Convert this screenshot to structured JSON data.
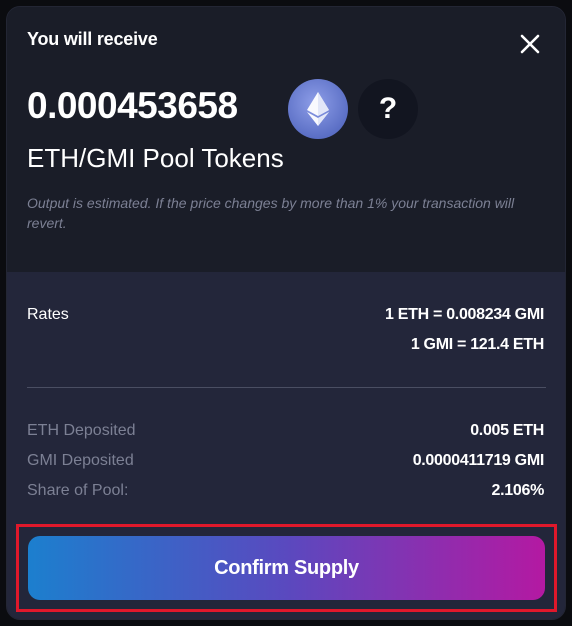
{
  "modal": {
    "title": "You will receive",
    "amount": "0.000453658",
    "pool_label": "ETH/GMI Pool Tokens",
    "note": "Output is estimated. If the price changes by more than 1% your transaction will revert.",
    "tokens": [
      {
        "icon": "ethereum-icon"
      },
      {
        "icon": "unknown-token-icon",
        "glyph": "?"
      }
    ]
  },
  "rates": {
    "label": "Rates",
    "rate1": "1 ETH = 0.008234 GMI",
    "rate2": "1 GMI = 121.4 ETH"
  },
  "details": {
    "eth_deposited_label": "ETH Deposited",
    "eth_deposited_value": "0.005 ETH",
    "gmi_deposited_label": "GMI Deposited",
    "gmi_deposited_value": "0.0000411719 GMI",
    "share_label": "Share of Pool:",
    "share_value": "2.106%"
  },
  "actions": {
    "confirm_label": "Confirm Supply"
  },
  "colors": {
    "modal_top_bg": "#1a1d28",
    "modal_bottom_bg": "#23263a",
    "highlight_border": "#e0182b",
    "button_gradient_start": "#1c7fce",
    "button_gradient_end": "#b419a2"
  }
}
